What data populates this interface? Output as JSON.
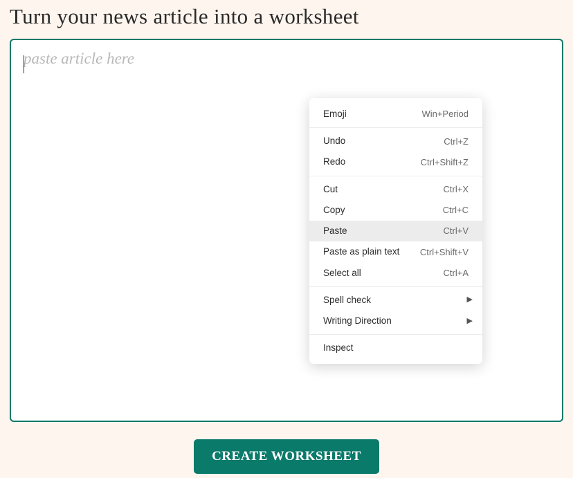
{
  "page": {
    "title": "Turn your news article into a worksheet"
  },
  "textarea": {
    "placeholder": "paste article here",
    "value": ""
  },
  "button": {
    "create_label": "CREATE WORKSHEET"
  },
  "context_menu": {
    "groups": [
      [
        {
          "label": "Emoji",
          "shortcut": "Win+Period",
          "submenu": false,
          "highlighted": false
        }
      ],
      [
        {
          "label": "Undo",
          "shortcut": "Ctrl+Z",
          "submenu": false,
          "highlighted": false
        },
        {
          "label": "Redo",
          "shortcut": "Ctrl+Shift+Z",
          "submenu": false,
          "highlighted": false
        }
      ],
      [
        {
          "label": "Cut",
          "shortcut": "Ctrl+X",
          "submenu": false,
          "highlighted": false
        },
        {
          "label": "Copy",
          "shortcut": "Ctrl+C",
          "submenu": false,
          "highlighted": false
        },
        {
          "label": "Paste",
          "shortcut": "Ctrl+V",
          "submenu": false,
          "highlighted": true
        },
        {
          "label": "Paste as plain text",
          "shortcut": "Ctrl+Shift+V",
          "submenu": false,
          "highlighted": false
        },
        {
          "label": "Select all",
          "shortcut": "Ctrl+A",
          "submenu": false,
          "highlighted": false
        }
      ],
      [
        {
          "label": "Spell check",
          "shortcut": "",
          "submenu": true,
          "highlighted": false
        },
        {
          "label": "Writing Direction",
          "shortcut": "",
          "submenu": true,
          "highlighted": false
        }
      ],
      [
        {
          "label": "Inspect",
          "shortcut": "",
          "submenu": false,
          "highlighted": false
        }
      ]
    ]
  }
}
